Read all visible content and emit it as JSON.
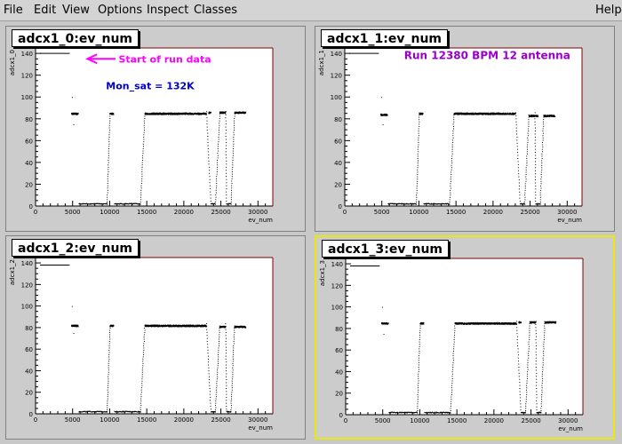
{
  "menu": {
    "items": [
      "File",
      "Edit",
      "View",
      "Options",
      "Inspect",
      "Classes"
    ],
    "help": "Help"
  },
  "annotations": {
    "start_of_run": "Start of run data",
    "mon_sat": "Mon_sat = 132K",
    "run_info": "Run 12380  BPM 12  antenna"
  },
  "colors": {
    "arrow": "#ff00ff",
    "mon_sat": "#0000cc",
    "run_info": "#9900cc",
    "frame_line": "#800000",
    "selected_border": "#e8e80a"
  },
  "chart_data": [
    {
      "type": "scatter",
      "title": "adcx1_0:ev_num",
      "xlabel": "ev_num",
      "ylabel": "adcx1_0",
      "xlim": [
        0,
        32000
      ],
      "ylim": [
        0,
        145
      ],
      "xticks": [
        0,
        5000,
        10000,
        15000,
        20000,
        25000,
        30000
      ],
      "yticks": [
        0,
        20,
        40,
        60,
        80,
        100,
        120,
        140
      ],
      "level": 85,
      "start_value": 140,
      "segments": [
        {
          "x_start": 4800,
          "x_end": 5700,
          "level": 85
        },
        {
          "x_start": 10000,
          "x_end": 10500,
          "level": 85
        },
        {
          "x_start": 14700,
          "x_end": 23000,
          "level": 85
        },
        {
          "x_start": 23300,
          "x_end": 23600,
          "level": 86
        },
        {
          "x_start": 24800,
          "x_end": 25600,
          "level": 86
        },
        {
          "x_start": 26800,
          "x_end": 28300,
          "level": 86
        }
      ],
      "low_segments": [
        {
          "x_start": 5800,
          "x_end": 9600,
          "level": 2
        },
        {
          "x_start": 10600,
          "x_end": 14100,
          "level": 2
        },
        {
          "x_start": 23600,
          "x_end": 24200,
          "level": 2
        },
        {
          "x_start": 25700,
          "x_end": 26300,
          "level": 2
        }
      ]
    },
    {
      "type": "scatter",
      "title": "adcx1_1:ev_num",
      "xlabel": "ev_num",
      "ylabel": "adcx1_1",
      "xlim": [
        0,
        32000
      ],
      "ylim": [
        0,
        145
      ],
      "xticks": [
        0,
        5000,
        10000,
        15000,
        20000,
        25000,
        30000
      ],
      "yticks": [
        0,
        20,
        40,
        60,
        80,
        100,
        120,
        140
      ],
      "level": 84,
      "start_value": 140,
      "segments": [
        {
          "x_start": 4800,
          "x_end": 5700,
          "level": 84
        },
        {
          "x_start": 10000,
          "x_end": 10500,
          "level": 85
        },
        {
          "x_start": 14700,
          "x_end": 23000,
          "level": 85
        },
        {
          "x_start": 24800,
          "x_end": 26000,
          "level": 83
        },
        {
          "x_start": 26800,
          "x_end": 28300,
          "level": 83
        }
      ],
      "low_segments": [
        {
          "x_start": 5800,
          "x_end": 9600,
          "level": 2
        },
        {
          "x_start": 10600,
          "x_end": 14100,
          "level": 2
        },
        {
          "x_start": 23600,
          "x_end": 24200,
          "level": 2
        },
        {
          "x_start": 25700,
          "x_end": 26300,
          "level": 2
        }
      ]
    },
    {
      "type": "scatter",
      "title": "adcx1_2:ev_num",
      "xlabel": "ev_num",
      "ylabel": "adcx1_2",
      "xlim": [
        0,
        32000
      ],
      "ylim": [
        0,
        145
      ],
      "xticks": [
        0,
        5000,
        10000,
        15000,
        20000,
        25000,
        30000
      ],
      "yticks": [
        0,
        20,
        40,
        60,
        80,
        100,
        120,
        140
      ],
      "level": 82,
      "start_value": 138,
      "segments": [
        {
          "x_start": 4800,
          "x_end": 5700,
          "level": 82
        },
        {
          "x_start": 10000,
          "x_end": 10500,
          "level": 82
        },
        {
          "x_start": 14700,
          "x_end": 23000,
          "level": 82
        },
        {
          "x_start": 24800,
          "x_end": 25600,
          "level": 81
        },
        {
          "x_start": 26800,
          "x_end": 28300,
          "level": 81
        }
      ],
      "low_segments": [
        {
          "x_start": 5800,
          "x_end": 9600,
          "level": 2
        },
        {
          "x_start": 10600,
          "x_end": 14100,
          "level": 2
        },
        {
          "x_start": 23600,
          "x_end": 24200,
          "level": 2
        },
        {
          "x_start": 25700,
          "x_end": 26300,
          "level": 2
        }
      ]
    },
    {
      "type": "scatter",
      "title": "adcx1_3:ev_num",
      "xlabel": "ev_num",
      "ylabel": "adcx1_3",
      "xlim": [
        0,
        32000
      ],
      "ylim": [
        0,
        145
      ],
      "xticks": [
        0,
        5000,
        10000,
        15000,
        20000,
        25000,
        30000
      ],
      "yticks": [
        0,
        20,
        40,
        60,
        80,
        100,
        120,
        140
      ],
      "level": 85,
      "start_value": 138,
      "segments": [
        {
          "x_start": 4800,
          "x_end": 5700,
          "level": 85
        },
        {
          "x_start": 10000,
          "x_end": 10500,
          "level": 85
        },
        {
          "x_start": 14700,
          "x_end": 23000,
          "level": 85
        },
        {
          "x_start": 23300,
          "x_end": 23600,
          "level": 86
        },
        {
          "x_start": 24800,
          "x_end": 25600,
          "level": 86
        },
        {
          "x_start": 26800,
          "x_end": 28300,
          "level": 86
        }
      ],
      "low_segments": [
        {
          "x_start": 5800,
          "x_end": 9600,
          "level": 2
        },
        {
          "x_start": 10600,
          "x_end": 14100,
          "level": 2
        },
        {
          "x_start": 23600,
          "x_end": 24200,
          "level": 2
        },
        {
          "x_start": 25700,
          "x_end": 26300,
          "level": 2
        }
      ]
    }
  ]
}
